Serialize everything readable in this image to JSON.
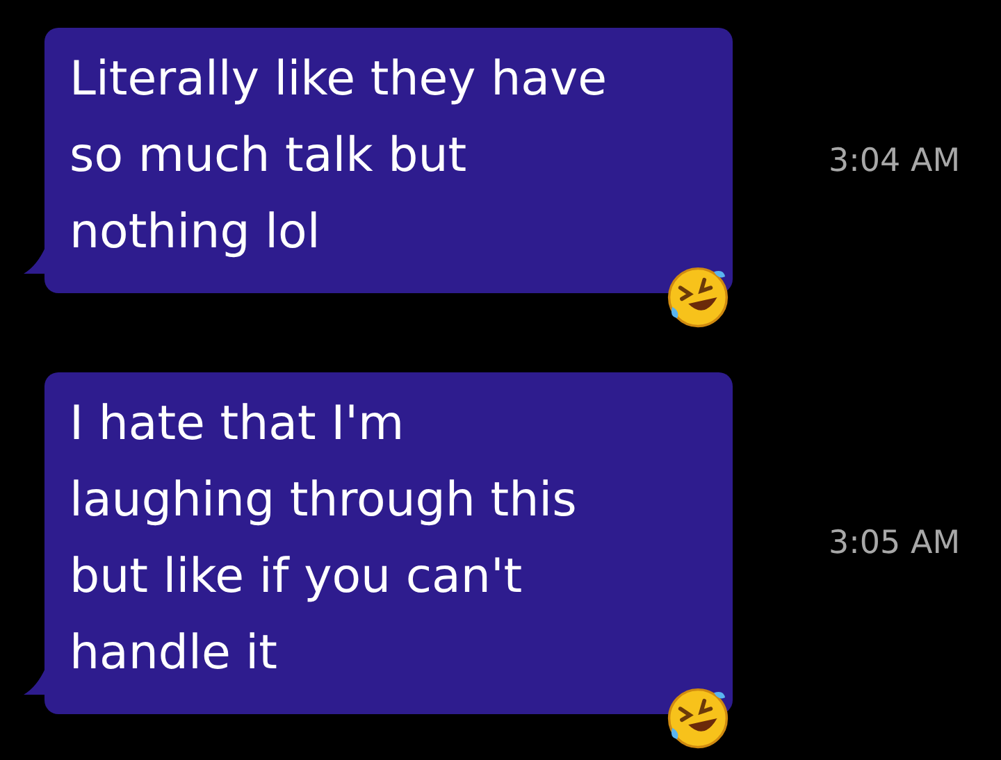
{
  "messages": [
    {
      "text": "Literally like they have\nso much talk but\nnothing lol",
      "time": "3:04 AM",
      "reacted": true
    },
    {
      "text": "I hate that I'm\nlaughing through this\nbut like if you can't\nhandle it",
      "time": "3:05 AM",
      "reacted": true
    }
  ]
}
